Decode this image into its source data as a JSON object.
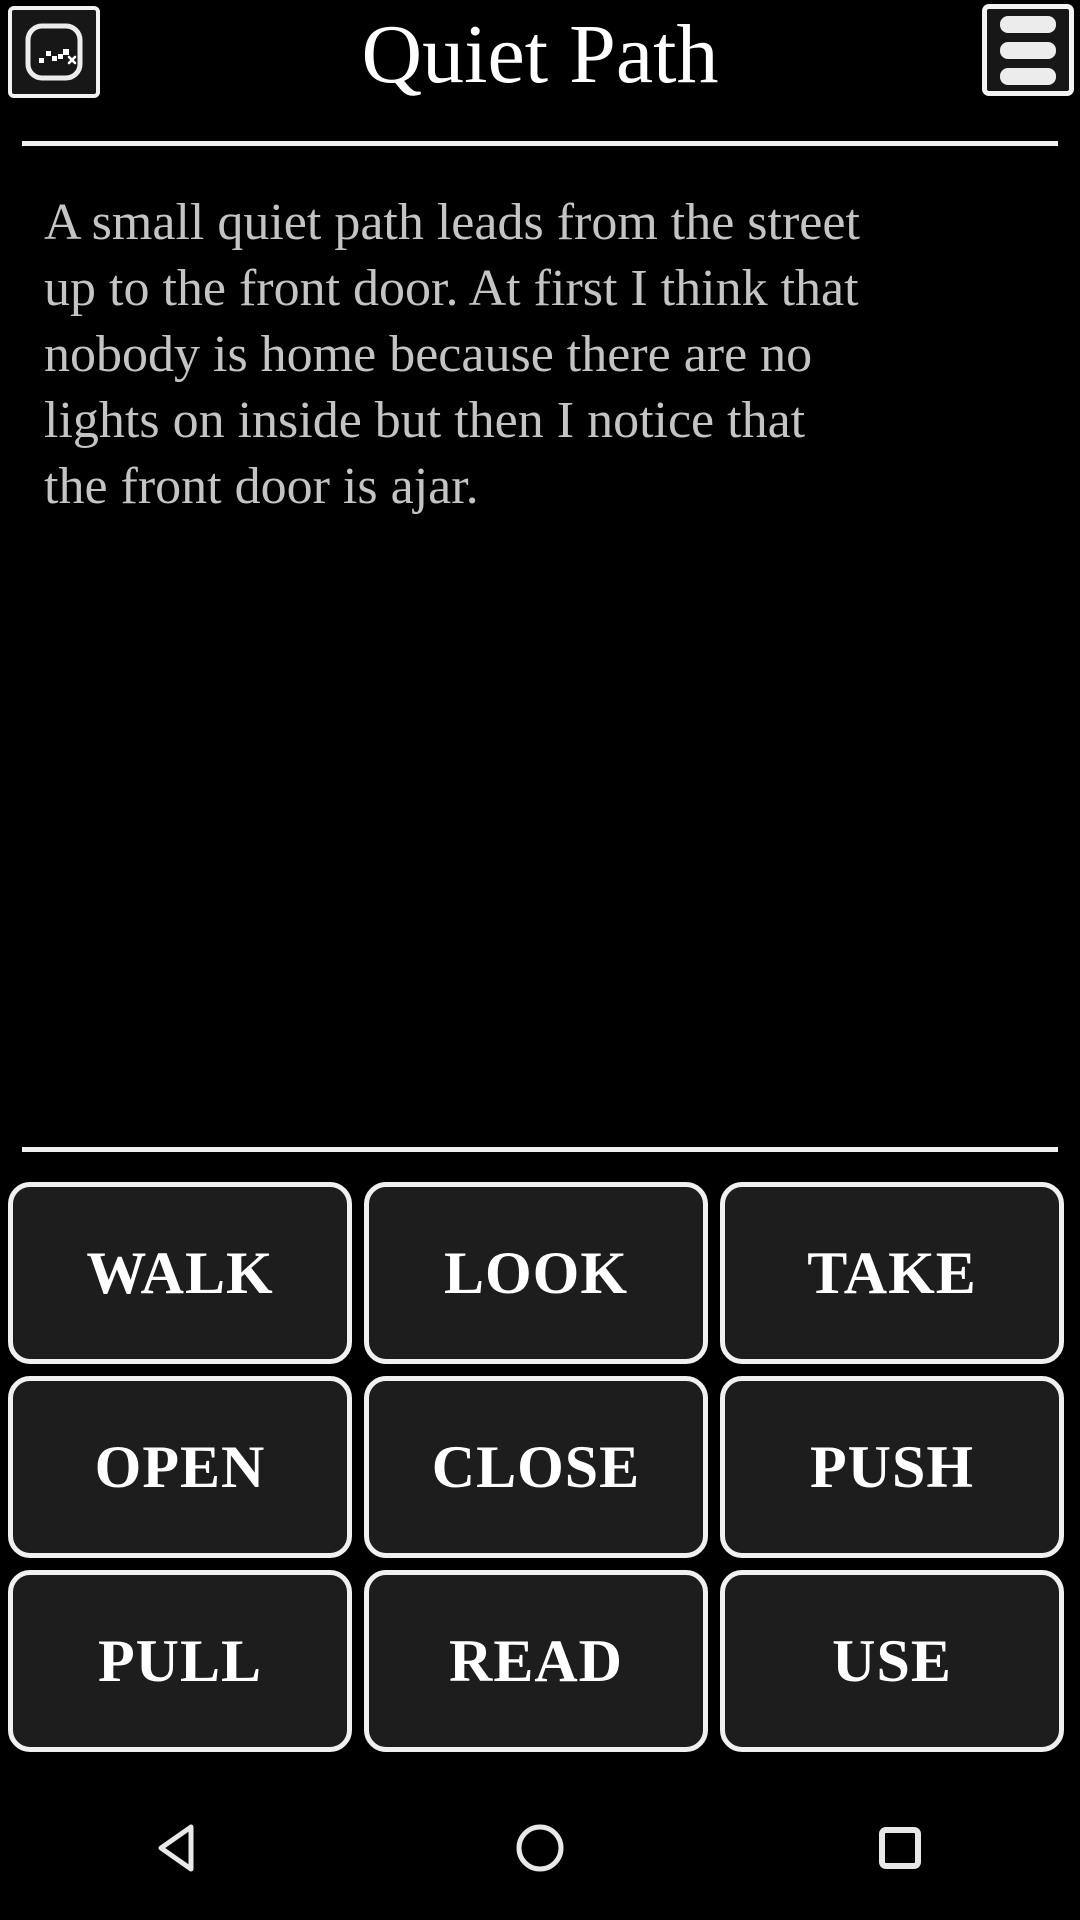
{
  "header": {
    "title": "Quiet Path",
    "map_button": {
      "icon": "map-path-icon",
      "label": "Map"
    },
    "menu_button": {
      "icon": "hamburger-menu-icon",
      "label": "Menu"
    }
  },
  "story": {
    "text": "A small quiet path leads from the street up to the front door. At first I think that nobody is home because there are no lights on inside but then I notice that the front door is ajar."
  },
  "verbs": [
    {
      "label": "WALK"
    },
    {
      "label": "LOOK"
    },
    {
      "label": "TAKE"
    },
    {
      "label": "OPEN"
    },
    {
      "label": "CLOSE"
    },
    {
      "label": "PUSH"
    },
    {
      "label": "PULL"
    },
    {
      "label": "READ"
    },
    {
      "label": "USE"
    }
  ],
  "navbar": {
    "back": {
      "icon": "triangle-back-icon"
    },
    "home": {
      "icon": "circle-home-icon"
    },
    "recents": {
      "icon": "square-recents-icon"
    }
  },
  "colors": {
    "background": "#000000",
    "text": "#c4c4c4",
    "title": "#ffffff",
    "button_fill": "#1d1d1d",
    "button_border": "#f0f0f0",
    "divider": "#f0f0f0"
  }
}
